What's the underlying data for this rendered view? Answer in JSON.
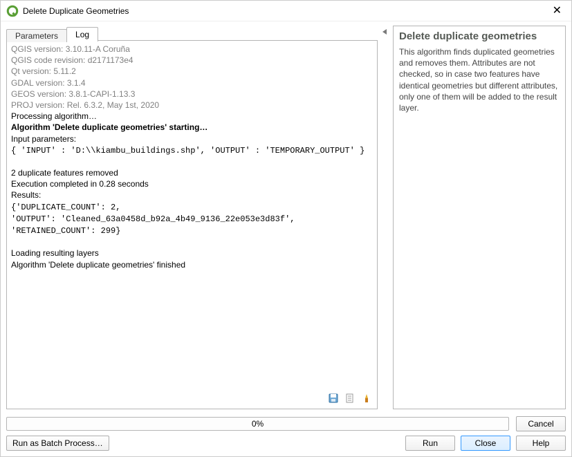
{
  "window": {
    "title": "Delete Duplicate Geometries"
  },
  "tabs": {
    "parameters": "Parameters",
    "log": "Log"
  },
  "log": {
    "sys1": "QGIS version: 3.10.11-A Coruña",
    "sys2": "QGIS code revision: d2171173e4",
    "sys3": "Qt version: 5.11.2",
    "sys4": "GDAL version: 3.1.4",
    "sys5": "GEOS version: 3.8.1-CAPI-1.13.3",
    "sys6": "PROJ version: Rel. 6.3.2, May 1st, 2020",
    "l1": "Processing algorithm…",
    "l2": "Algorithm 'Delete duplicate geometries' starting…",
    "l3": "Input parameters:",
    "l4": "{ 'INPUT' : 'D:\\\\kiambu_buildings.shp', 'OUTPUT' : 'TEMPORARY_OUTPUT' }",
    "l5": "2 duplicate features removed",
    "l6": "Execution completed in 0.28 seconds",
    "l7": "Results:",
    "l8": "{'DUPLICATE_COUNT': 2,",
    "l9": "'OUTPUT': 'Cleaned_63a0458d_b92a_4b49_9136_22e053e3d83f',",
    "l10": "'RETAINED_COUNT': 299}",
    "l11": "Loading resulting layers",
    "l12": "Algorithm 'Delete duplicate geometries' finished"
  },
  "help": {
    "title": "Delete duplicate geometries",
    "body": "This algorithm finds duplicated geometries and removes them. Attributes are not checked, so in case two features have identical geometries but different attributes, only one of them will be added to the result layer."
  },
  "progress": {
    "text": "0%"
  },
  "buttons": {
    "cancel": "Cancel",
    "batch": "Run as Batch Process…",
    "run": "Run",
    "close": "Close",
    "helpbtn": "Help"
  }
}
